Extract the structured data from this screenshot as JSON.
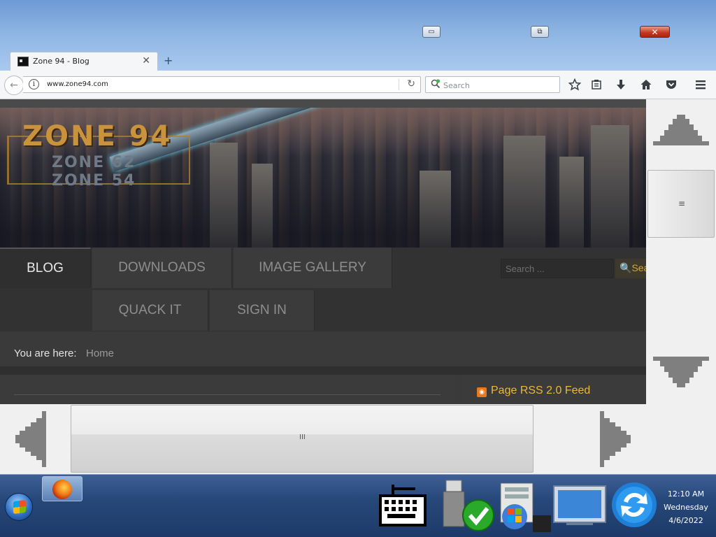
{
  "window": {
    "minimize_glyph": "▭",
    "maximize_glyph": "⧉",
    "close_glyph": "✕"
  },
  "tab": {
    "title": "Zone 94 - Blog",
    "close_glyph": "✕",
    "new_tab_glyph": "+"
  },
  "navbar": {
    "back_glyph": "←",
    "info_glyph": "i",
    "url": "www.zone94.com",
    "reload_glyph": "↻",
    "search_placeholder": "Search",
    "search_icon": "magnifier-plus-icon",
    "toolbar_icons": [
      "bookmark-star-icon",
      "reading-list-icon",
      "downloads-icon",
      "home-icon",
      "pocket-icon",
      "menu-icon"
    ]
  },
  "site": {
    "logo_main": "ZONE 94",
    "logo_sub1": "ZONE 62",
    "logo_sub2": "ZONE 54",
    "menu": [
      {
        "label": "BLOG",
        "active": true
      },
      {
        "label": "DOWNLOADS",
        "active": false
      },
      {
        "label": "IMAGE GALLERY",
        "active": false
      },
      {
        "label": "QUACK IT",
        "active": false
      },
      {
        "label": "SIGN IN",
        "active": false
      }
    ],
    "search_placeholder": "Search ...",
    "search_button": "Sea",
    "breadcrumb_label": "You are here:",
    "breadcrumb_home": "Home",
    "rss_label": "Page RSS 2.0 Feed",
    "colors": {
      "accent": "#e8b93c",
      "menu_bg": "#3b3b3b",
      "rss": "#e8791c"
    }
  },
  "scrollbars": {
    "vertical_grip": "≡",
    "horizontal_grip": "III"
  },
  "taskbar": {
    "pinned": [
      "firefox-icon"
    ],
    "tray": [
      "on-screen-keyboard-icon",
      "usb-safely-remove-icon",
      "windows-update-icon",
      "display-icon",
      "sync-icon"
    ],
    "clock": {
      "time": "12:10 AM",
      "day": "Wednesday",
      "date": "4/6/2022"
    }
  }
}
